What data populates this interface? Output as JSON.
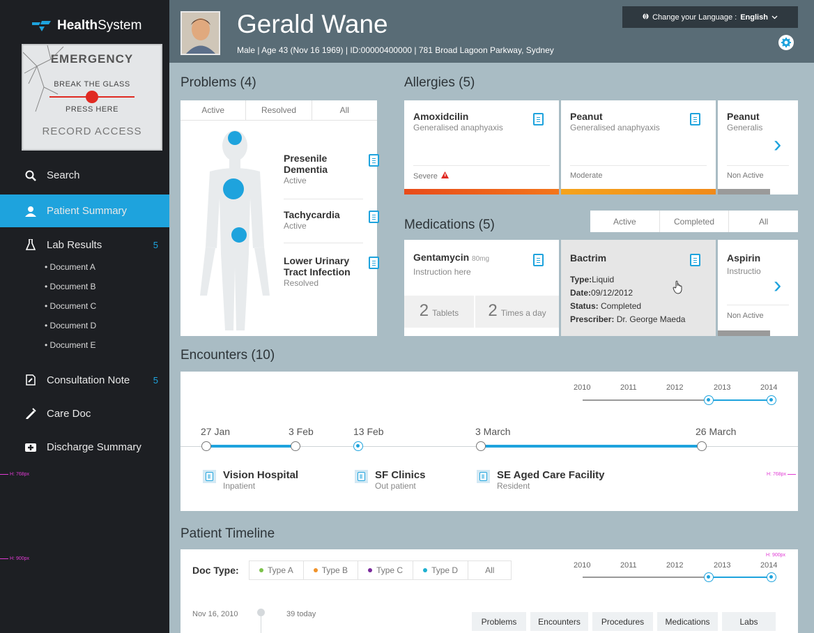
{
  "sidebar": {
    "logo_bold": "Health",
    "logo_light": "System",
    "emergency": {
      "title": "EMERGENCY",
      "line1": "BREAK THE GLASS",
      "line2": "PRESS HERE",
      "line3": "RECORD ACCESS"
    },
    "nav": [
      {
        "label": "Search",
        "icon": "search-icon"
      },
      {
        "label": "Patient Summary",
        "icon": "user-icon"
      },
      {
        "label": "Lab Results",
        "icon": "flask-icon",
        "badge": "5"
      },
      {
        "label": "Consultation Note",
        "icon": "note-icon",
        "badge": "5"
      },
      {
        "label": "Care Doc",
        "icon": "pen-icon"
      },
      {
        "label": "Discharge Summary",
        "icon": "medkit-icon"
      }
    ],
    "lab_docs": [
      "• Document A",
      "• Document B",
      "• Document C",
      "• Document D",
      "• Document E"
    ],
    "guide_768": "H: 768px",
    "guide_900": "H: 900px"
  },
  "header": {
    "name": "Gerald Wane",
    "info": "Male | Age 43 (Nov 16 1969) | ID:00000400000 | 781 Broad Lagoon Parkway, Sydney",
    "language_label": "Change your Language :",
    "language_value": "English"
  },
  "problems": {
    "title": "Problems (4)",
    "tabs": [
      "Active",
      "Resolved",
      "All"
    ],
    "items": [
      {
        "name_l1": "Presenile",
        "name_l2": "Dementia",
        "status": "Active"
      },
      {
        "name_l1": "Tachycardia",
        "name_l2": "",
        "status": "Active"
      },
      {
        "name_l1": "Lower Urinary",
        "name_l2": "Tract Infection",
        "status": "Resolved"
      }
    ]
  },
  "allergies": {
    "title": "Allergies (5)",
    "items": [
      {
        "name": "Amoxidcilin",
        "reaction": "Generalised anaphyaxis",
        "severity": "Severe",
        "bar": "#e84b1a"
      },
      {
        "name": "Peanut",
        "reaction": "Generalised anaphyaxis",
        "severity": "Moderate",
        "bar": "#f5a31c"
      },
      {
        "name": "Peanut",
        "reaction": "Generalis",
        "severity": "Non Active",
        "bar": "#9a9a9a"
      }
    ]
  },
  "medications": {
    "title": "Medications (5)",
    "tabs": [
      "Active",
      "Completed",
      "All"
    ],
    "gentamycin": {
      "name": "Gentamycin",
      "dose": "80mg",
      "instruction": "Instruction here",
      "qty1": "2",
      "unit1": "Tablets",
      "qty2": "2",
      "unit2": "Times a day"
    },
    "bactrim": {
      "name": "Bactrim",
      "type_label": "Type:",
      "type": "Liquid",
      "date_label": "Date:",
      "date": "09/12/2012",
      "status_label": "Status:",
      "status": "Completed",
      "prescriber_label": "Prescriber:",
      "prescriber": "Dr. George Maeda"
    },
    "aspirin": {
      "name": "Aspirin",
      "instruction": "Instructio",
      "status": "Non Active"
    }
  },
  "encounters": {
    "title": "Encounters (10)",
    "years": [
      "2010",
      "2011",
      "2012",
      "2013",
      "2014"
    ],
    "dates": [
      "27 Jan",
      "3 Feb",
      "13 Feb",
      "3 March",
      "26 March"
    ],
    "facilities": [
      {
        "name": "Vision Hospital",
        "type": "Inpatient"
      },
      {
        "name": "SF Clinics",
        "type": "Out patient"
      },
      {
        "name": "SE Aged Care Facility",
        "type": "Resident"
      }
    ]
  },
  "timeline": {
    "title": "Patient Timeline",
    "doc_type_label": "Doc Type:",
    "types": [
      {
        "label": "Type A",
        "color": "#7cc24b"
      },
      {
        "label": "Type B",
        "color": "#f0922a"
      },
      {
        "label": "Type C",
        "color": "#7a2a9c"
      },
      {
        "label": "Type D",
        "color": "#1eb0d0"
      }
    ],
    "type_all": "All",
    "years": [
      "2010",
      "2011",
      "2012",
      "2013",
      "2014"
    ],
    "entry_date": "Nov 16, 2010",
    "entry_note": "39 today",
    "categories": [
      "Problems",
      "Encounters",
      "Procedures",
      "Medications",
      "Labs"
    ]
  },
  "colors": {
    "accent": "#1ea3dd",
    "sidebar_bg": "#1d1f23",
    "header_bg": "#596c76",
    "main_bg": "#a9bcc4"
  }
}
